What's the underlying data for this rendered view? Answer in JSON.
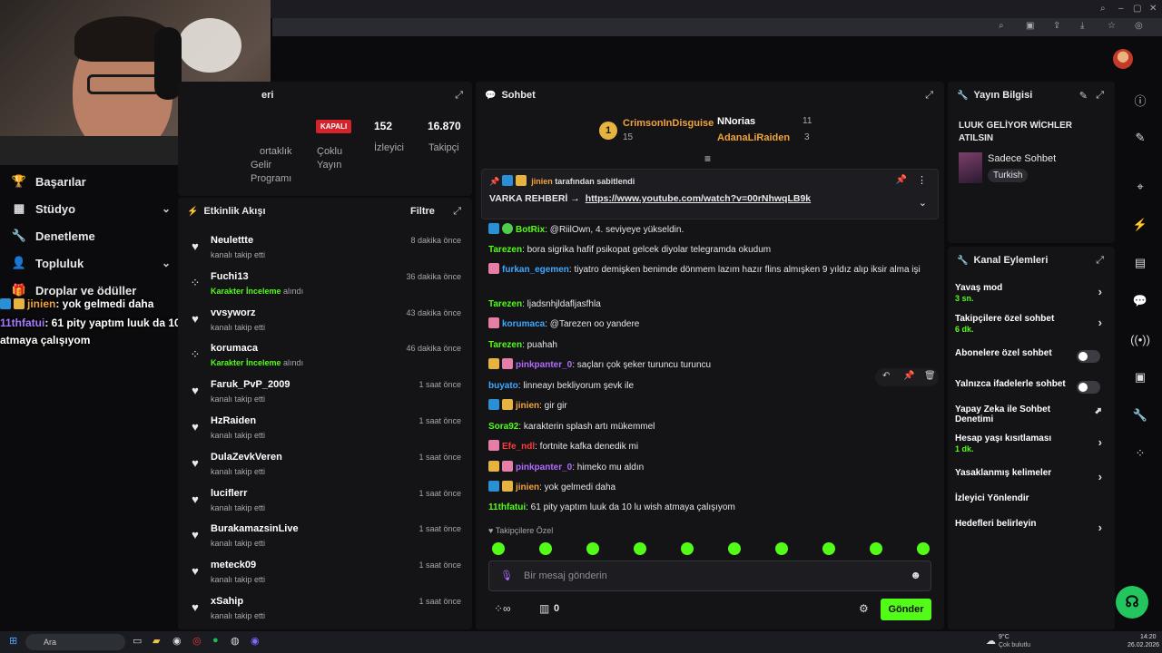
{
  "stream_info": {
    "section_title": "eri",
    "status_badge": "KAPALI",
    "status_label_1": "Çoklu",
    "status_label_2": "Yayın",
    "viewers_value": "152",
    "viewers_label": "İzleyici",
    "followers_value": "16.870",
    "followers_label": "Takipçi",
    "partner_line1": "ortaklık",
    "partner_line2": "Gelir",
    "partner_line3": "Programı"
  },
  "left_nav": {
    "items": [
      {
        "label": "Başarılar",
        "icon": "trophy-icon"
      },
      {
        "label": "Stüdyo",
        "icon": "grid-icon",
        "has_chevron": true
      },
      {
        "label": "Denetleme",
        "icon": "wrench-icon"
      },
      {
        "label": "Topluluk",
        "icon": "user-icon",
        "has_chevron": true
      },
      {
        "label": "Droplar ve ödüller",
        "icon": "gift-icon"
      }
    ]
  },
  "overlay_chat": [
    {
      "user": "jinien",
      "text": ": yok gelmedi daha"
    },
    {
      "user": "11thfatui",
      "text": ": 61 pity yaptım luuk da 10 lu wish"
    },
    {
      "user": "",
      "text": "atmaya çalışıyom"
    }
  ],
  "activity": {
    "title": "Etkinlik Akışı",
    "filter_label": "Filtre",
    "rows": [
      {
        "name": "Neulettte",
        "action": "kanalı takip etti",
        "time": "8 dakika önce",
        "icon": "heart-icon"
      },
      {
        "name": "Fuchi13",
        "highlight": "Karakter İnceleme",
        "action": " alındı",
        "time": "36 dakika önce",
        "icon": "reward-icon"
      },
      {
        "name": "vvsyworz",
        "action": "kanalı takip etti",
        "time": "43 dakika önce",
        "icon": "heart-icon"
      },
      {
        "name": "korumaca",
        "highlight": "Karakter İnceleme",
        "action": " alındı",
        "time": "46 dakika önce",
        "icon": "reward-icon"
      },
      {
        "name": "Faruk_PvP_2009",
        "action": "kanalı takip etti",
        "time": "1 saat önce",
        "icon": "heart-icon"
      },
      {
        "name": "HzRaiden",
        "action": "kanalı takip etti",
        "time": "1 saat önce",
        "icon": "heart-icon"
      },
      {
        "name": "DulaZevkVeren",
        "action": "kanalı takip etti",
        "time": "1 saat önce",
        "icon": "heart-icon"
      },
      {
        "name": "luciflerr",
        "action": "kanalı takip etti",
        "time": "1 saat önce",
        "icon": "heart-icon"
      },
      {
        "name": "BurakamazsinLive",
        "action": "kanalı takip etti",
        "time": "1 saat önce",
        "icon": "heart-icon"
      },
      {
        "name": "meteck09",
        "action": "kanalı takip etti",
        "time": "1 saat önce",
        "icon": "heart-icon"
      },
      {
        "name": "xSahip",
        "action": "kanalı takip etti",
        "time": "1 saat önce",
        "icon": "heart-icon"
      }
    ]
  },
  "chat": {
    "title": "Sohbet",
    "top_gifters": [
      {
        "rank": "1",
        "name": "CrimsonInDisguise",
        "count": "15",
        "color": "#f2a33a"
      },
      {
        "name": "NNorias",
        "count": "11",
        "color": "#ffffff"
      },
      {
        "name": "AdanaLiRaiden",
        "count": "3",
        "color": "#f2a33a"
      }
    ],
    "pinned": {
      "by_user": "jinien",
      "by_text": "tarafından sabitlendi",
      "title": "VARKA REHBERİ →",
      "link": "https://www.youtube.com/watch?v=00rNhwqLB9k"
    },
    "messages": [
      {
        "user": "BotRix",
        "color": "#53fc18",
        "text": ": @RiilOwn, 4. seviyeye yükseldin.",
        "badges": [
          "b-blue",
          "b-green"
        ]
      },
      {
        "user": "Tarezen",
        "color": "#53fc18",
        "text": ": bora sigrika hafif psikopat gelcek diyolar telegramda okudum",
        "badges": []
      },
      {
        "user": "furkan_egemen",
        "color": "#3fa7ff",
        "text": ": tiyatro demişken benimde dönmem lazım hazır flins almışken 9 yıldız alıp iksir alma işi",
        "badges": [
          "b-pink"
        ]
      },
      {
        "user": "Tarezen",
        "color": "#53fc18",
        "text": ": ljadsnhjldafljasfhla",
        "badges": []
      },
      {
        "user": "korumaca",
        "color": "#3fa7ff",
        "text": ": @Tarezen oo yandere",
        "badges": [
          "b-pink"
        ]
      },
      {
        "user": "Tarezen",
        "color": "#53fc18",
        "text": ": puahah",
        "badges": []
      },
      {
        "user": "pinkpanter_0",
        "color": "#b36bff",
        "text": ": saçları çok şeker turuncu turuncu",
        "badges": [
          "b-gold",
          "b-pink"
        ]
      },
      {
        "user": "buyato",
        "color": "#3fa7ff",
        "text": ": linneayı bekliyorum şevk ile",
        "badges": []
      },
      {
        "user": "jinien",
        "color": "#f2a33a",
        "text": ": gir gir",
        "badges": [
          "b-blue",
          "b-gold"
        ]
      },
      {
        "user": "Sora92",
        "color": "#53fc18",
        "text": ": karakterin splash artı mükemmel",
        "badges": []
      },
      {
        "user": "Efe_ndl",
        "color": "#ff3b3b",
        "text": ": fortnite kafka denedik mi",
        "badges": [
          "b-pink"
        ]
      },
      {
        "user": "pinkpanter_0",
        "color": "#b36bff",
        "text": ": himeko mu aldın",
        "badges": [
          "b-gold",
          "b-pink"
        ]
      },
      {
        "user": "jinien",
        "color": "#f2a33a",
        "text": ": yok gelmedi daha",
        "badges": [
          "b-blue",
          "b-gold"
        ]
      },
      {
        "user": "11thfatui",
        "color": "#53fc18",
        "text": ": 61 pity yaptım luuk da 10 lu wish atmaya çalışıyom",
        "badges": []
      }
    ],
    "follower_only_label": "Takipçilere Özel",
    "input_placeholder": "Bir mesaj gönderin",
    "points": "0",
    "send_label": "Gönder"
  },
  "stream_preview": {
    "title": "Yayın Bilgisi",
    "stream_title": "LUUK GELİYOR WİCHLER ATILSIN",
    "category": "Sadece Sohbet",
    "tag": "Turkish"
  },
  "channel_actions": {
    "title": "Kanal Eylemleri",
    "items": [
      {
        "label": "Yavaş mod",
        "sub": "3 sn.",
        "control": "chevron"
      },
      {
        "label": "Takipçilere özel sohbet",
        "sub": "6 dk.",
        "control": "chevron"
      },
      {
        "label": "Abonelere özel sohbet",
        "control": "toggle"
      },
      {
        "label": "Yalnızca ifadelerle sohbet",
        "control": "toggle"
      },
      {
        "label": "Yapay Zeka ile Sohbet Denetimi",
        "control": "external"
      },
      {
        "label": "Hesap yaşı kısıtlaması",
        "sub": "1 dk.",
        "control": "chevron"
      },
      {
        "label": "Yasaklanmış kelimeler",
        "control": "chevron"
      },
      {
        "label": "İzleyici Yönlendir",
        "control": "none"
      },
      {
        "label": "Hedefleri belirleyin",
        "control": "chevron"
      }
    ]
  },
  "taskbar": {
    "search_placeholder": "Ara",
    "weather_temp": "9°C",
    "weather_desc": "Çok bulutlu",
    "time": "14:20",
    "date": "26.02.2026"
  },
  "colors": {
    "accent": "#53fc18",
    "panel": "#141417",
    "live_off": "#d3242b"
  }
}
